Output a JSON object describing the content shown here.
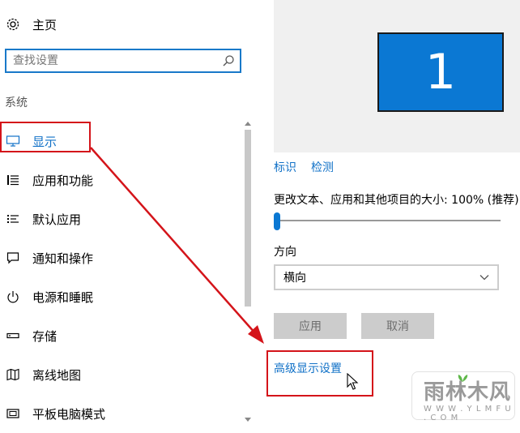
{
  "sidebar": {
    "home_label": "主页",
    "search_placeholder": "查找设置",
    "section_label": "系统",
    "items": [
      {
        "label": "显示",
        "icon": "monitor-icon"
      },
      {
        "label": "应用和功能",
        "icon": "apps-list-icon"
      },
      {
        "label": "默认应用",
        "icon": "default-apps-icon"
      },
      {
        "label": "通知和操作",
        "icon": "notification-icon"
      },
      {
        "label": "电源和睡眠",
        "icon": "power-icon"
      },
      {
        "label": "存储",
        "icon": "storage-icon"
      },
      {
        "label": "离线地图",
        "icon": "map-icon"
      },
      {
        "label": "平板电脑模式",
        "icon": "tablet-icon"
      }
    ]
  },
  "display": {
    "monitor_number": "1",
    "identify_label": "标识",
    "detect_label": "检测",
    "scale_label": "更改文本、应用和其他项目的大小: 100% (推荐)",
    "scale_percent": 0,
    "orientation_label": "方向",
    "orientation_value": "横向",
    "apply_label": "应用",
    "cancel_label": "取消",
    "advanced_label": "高级显示设置"
  },
  "colors": {
    "accent": "#0b78d3",
    "link": "#1171c7",
    "annotation": "#d4141a"
  },
  "watermark": {
    "brand": "雨林木风",
    "url": "W W W . Y L M F U . C O M"
  }
}
